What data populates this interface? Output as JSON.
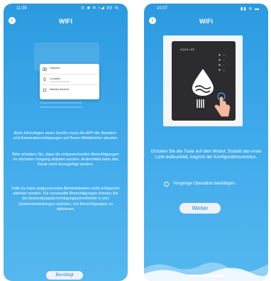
{
  "left_screen": {
    "status": {
      "time": "11:09",
      "icons": "⏱ ✱ ✉ ▾◢ 89 %"
    },
    "title": "WIFI",
    "permission_items": [
      {
        "label": "Camera",
        "sub": ""
      },
      {
        "label": "Location",
        "sub": "Last accessed 15:00"
      },
      {
        "label": "Nearby devices",
        "sub": ""
      }
    ],
    "paragraph_1": "Beim Hinzufügen eines Geräts muss die APP die Standort- und Kameraberechtigungen auf Ihrem Mobiltelefon abrufen.",
    "paragraph_2": "Bitte erlauben Sie, dass die entsprechenden Berechtigungen im nächsten Vorgang aktiviert werden. Andernfalls kann das Gerät nicht hinzugefügt werden.",
    "paragraph_3": "Falls Es kann aufgrund eines Betriebsfehlers nicht erfolgreich aktiviert werden. Für verwandte Berechtigungen können Sie die Anwendungsberechtigungsschnittstelle in den Systemeinstellungen aufrufen, um Berechtigungen zu aktivieren.",
    "confirm_button": "Bestätigt"
  },
  "right_screen": {
    "status": {
      "time": "10:07",
      "icons": "▮▮ ≋ ▬"
    },
    "title": "WiFi",
    "device_brand": "AQUA·LED",
    "instruction": "Drücken Sie die Taste auf dem Modul. Sobald das erste Licht aufleuchtet, beginnt der Konfigurationsmodus.",
    "radio_label": "Vorgerige Operation bestätigen",
    "next_button": "Weiter"
  },
  "colors": {
    "accent": "#2b9ae0",
    "button_text": "#2b8ad8"
  }
}
